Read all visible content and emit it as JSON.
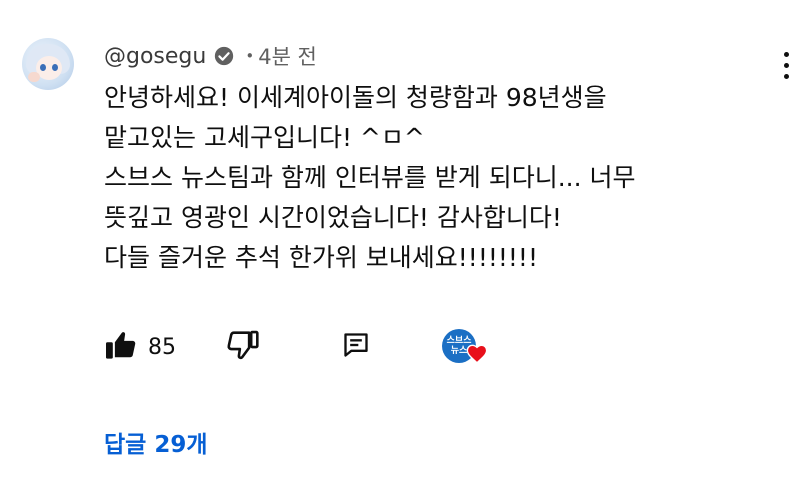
{
  "comment": {
    "username": "@gosegu",
    "time_ago": "4분 전",
    "separator": "•",
    "lines": [
      "안녕하세요! 이세계아이돌의 청량함과 98년생을",
      "맡고있는 고세구입니다! ^ㅁ^",
      "스브스 뉴스팀과 함께 인터뷰를 받게 되다니... 너무",
      "뜻깊고 영광인 시간이었습니다! 감사합니다!",
      "다들 즐거운 추석 한가위 보내세요!!!!!!!!"
    ],
    "like_count": "85",
    "creator_badge": {
      "line1": "스브스",
      "line2": "뉴스"
    },
    "replies_label": "답글 29개"
  },
  "icons": {
    "verified": "verified-check-icon",
    "like": "thumbs-up-icon",
    "dislike": "thumbs-down-icon",
    "reply": "reply-comment-icon",
    "menu": "more-vertical-icon",
    "heart": "creator-heart-icon"
  },
  "colors": {
    "link": "#065fd4",
    "heart": "#e8101b",
    "badge": "#1b6fc4",
    "meta": "#606060"
  }
}
